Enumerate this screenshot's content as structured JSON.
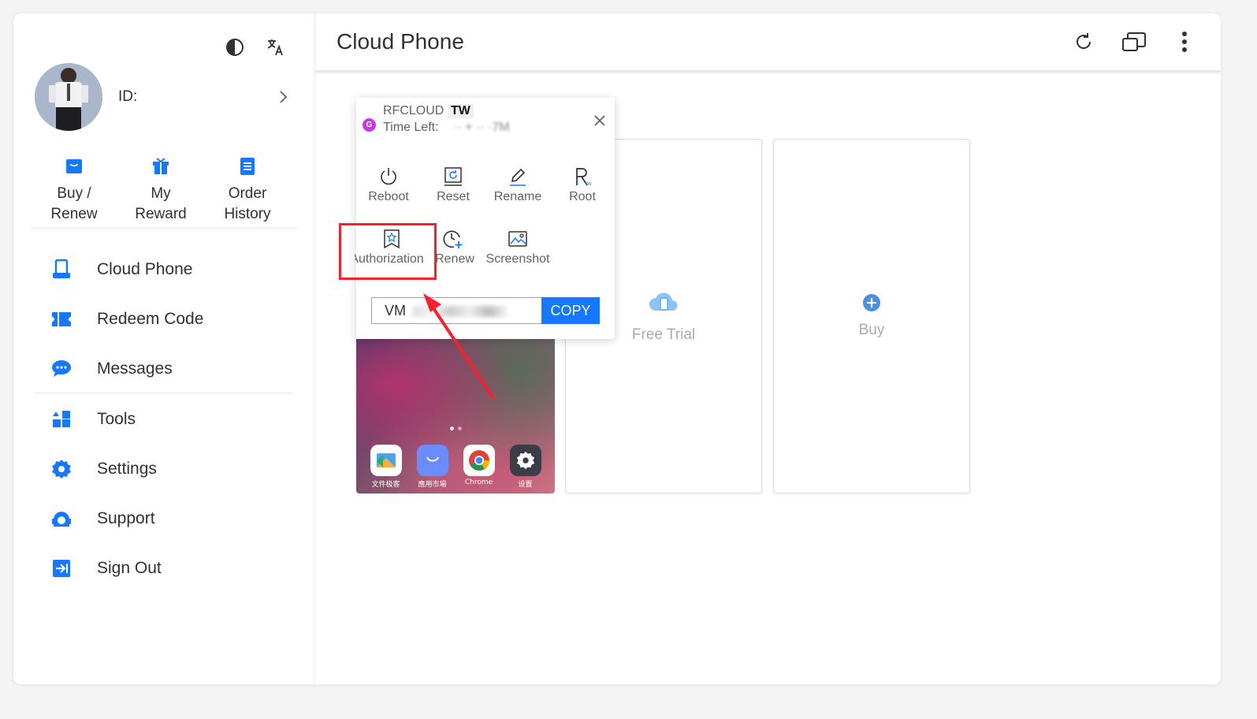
{
  "sidebar": {
    "id_label": "ID:",
    "quick_actions": [
      {
        "label": "Buy /\nRenew",
        "icon": "shopping-bag-icon"
      },
      {
        "label": "My\nReward",
        "icon": "gift-icon"
      },
      {
        "label": "Order\nHistory",
        "icon": "clipboard-icon"
      }
    ],
    "nav": [
      {
        "label": "Cloud Phone",
        "icon": "phone-icon"
      },
      {
        "label": "Redeem Code",
        "icon": "ticket-icon"
      },
      {
        "label": "Messages",
        "icon": "chat-icon"
      },
      {
        "label": "Tools",
        "icon": "tools-icon"
      },
      {
        "label": "Settings",
        "icon": "gear-icon"
      },
      {
        "label": "Support",
        "icon": "support-icon"
      },
      {
        "label": "Sign Out",
        "icon": "sign-out-icon"
      }
    ]
  },
  "header": {
    "title": "Cloud Phone"
  },
  "popover": {
    "badge": "G",
    "device_name": "RFCLOUD",
    "region": "TW",
    "time_left_label": "Time Left:",
    "time_left_value": "·· + ·· ·7M",
    "operations": [
      {
        "label": "Reboot",
        "icon": "power-icon"
      },
      {
        "label": "Reset",
        "icon": "reset-icon"
      },
      {
        "label": "Rename",
        "icon": "pencil-icon"
      },
      {
        "label": "Root",
        "icon": "root-icon"
      },
      {
        "label": "Authorization",
        "icon": "authorization-icon"
      },
      {
        "label": "Renew",
        "icon": "renew-clock-icon"
      },
      {
        "label": "Screenshot",
        "icon": "image-icon"
      }
    ],
    "code_value": "VM",
    "copy_label": "COPY"
  },
  "cards": {
    "free_trial": "Free Trial",
    "buy": "Buy"
  },
  "phone_apps": [
    {
      "label": "文件极客"
    },
    {
      "label": "應用市場"
    },
    {
      "label": "Chrome"
    },
    {
      "label": "设置"
    }
  ],
  "colors": {
    "accent": "#1677ff",
    "highlight": "#f5222d"
  }
}
